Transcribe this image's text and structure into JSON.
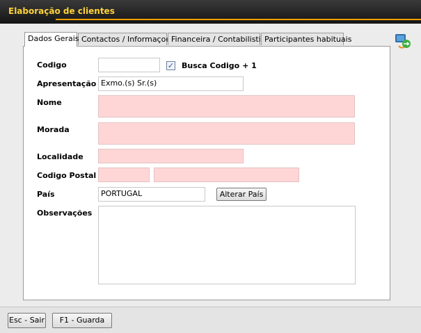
{
  "window": {
    "title": "Elaboração de clientes"
  },
  "tabs": [
    {
      "label": "Dados Gerais"
    },
    {
      "label": "Contactos / Informaçoes"
    },
    {
      "label": "Financeira / Contabilistica"
    },
    {
      "label": "Participantes habituais"
    }
  ],
  "form": {
    "codigo_label": "Codigo",
    "codigo_value": "",
    "busca_label": "Busca Codigo + 1",
    "busca_checked": "✓",
    "apresentacao_label": "Apresentação",
    "apresentacao_value": "Exmo.(s) Sr.(s)",
    "nome_label": "Nome",
    "nome_value": "",
    "morada_label": "Morada",
    "morada_value": "",
    "localidade_label": "Localidade",
    "localidade_value": "",
    "codigo_postal_label": "Codigo Postal",
    "codigo_postal_1": "",
    "codigo_postal_2": "",
    "pais_label": "País",
    "pais_value": "PORTUGAL",
    "alterar_pais_label": "Alterar País",
    "observacoes_label": "Observações",
    "observacoes_value": ""
  },
  "footer": {
    "sair_label": "Esc - Sair",
    "guarda_label": "F1 - Guarda"
  },
  "colors": {
    "title_text": "#ffd23a",
    "accent_line": "#f5a000",
    "required_field": "#ffd6d6"
  },
  "icons": {
    "corner": "user-transfer-icon"
  }
}
